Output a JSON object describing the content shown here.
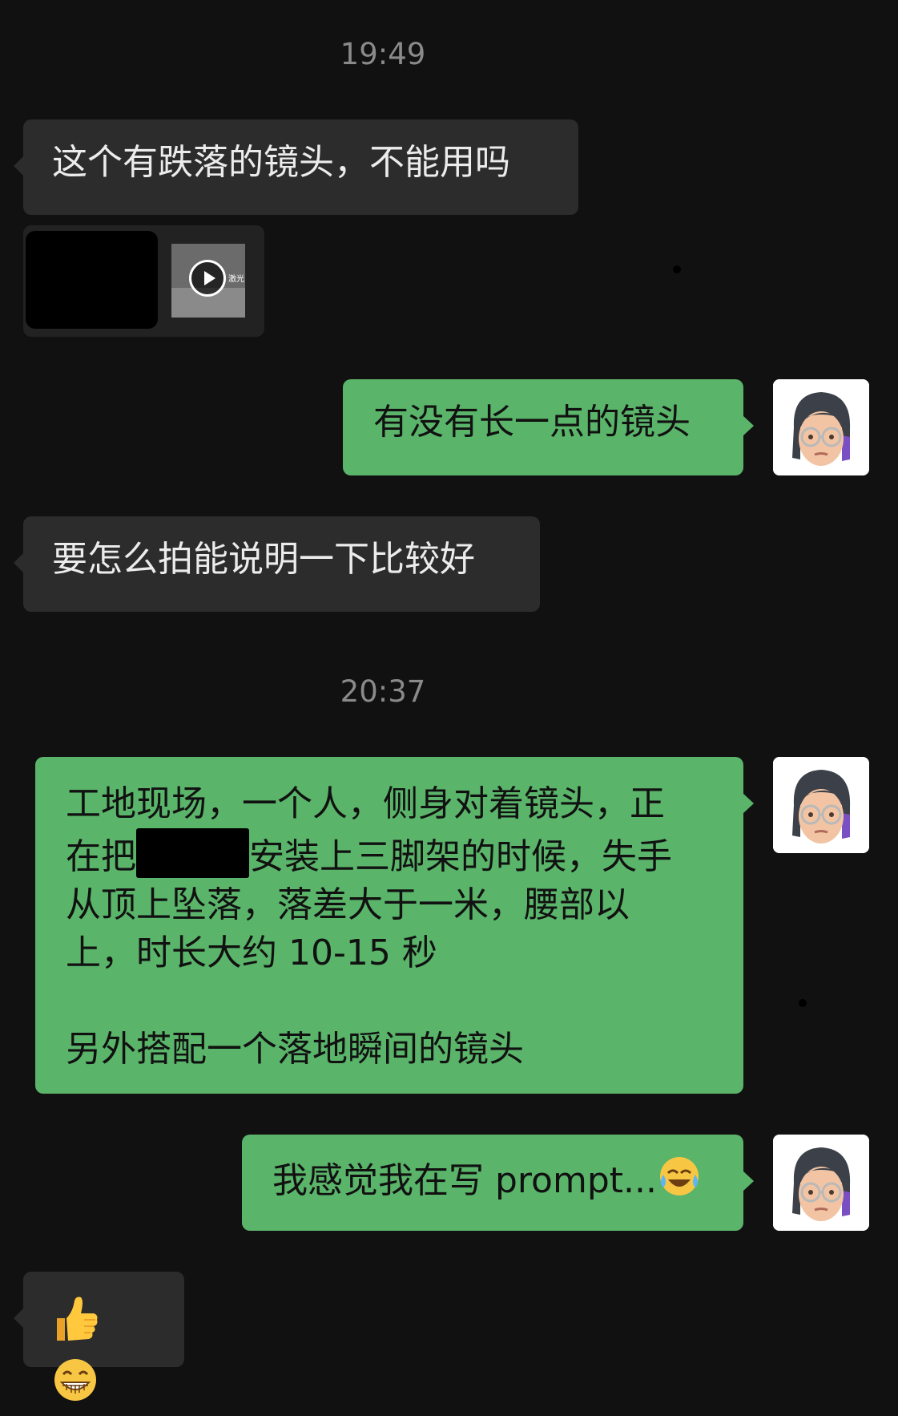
{
  "chat": {
    "timestamp_1": "19:49",
    "msg_1": "这个有跌落的镜头，不能用吗",
    "video_thumb_text": "激光",
    "msg_2": "有没有长一点的镜头",
    "msg_3": "要怎么拍能说明一下比较好",
    "timestamp_2": "20:37",
    "msg_4": {
      "line_1": "工地现场，一个人，侧身对着镜头，正",
      "line_2_before": "在把",
      "line_2_after": "安装上三脚架的时候，失手",
      "line_3": "从顶上坠落，落差大于一米，腰部以",
      "line_4": "上，时长大约 10-15 秒",
      "line_5": "另外搭配一个落地瞬间的镜头"
    },
    "msg_5": "我感觉我在写 prompt...",
    "msg_5_emoji": "face-with-tears-of-joy",
    "msg_6_emojis": [
      "thumbs-up",
      "grinning-face"
    ]
  },
  "colors": {
    "background": "#111111",
    "incoming_bubble": "#2c2c2c",
    "outgoing_bubble": "#5ab46a"
  }
}
